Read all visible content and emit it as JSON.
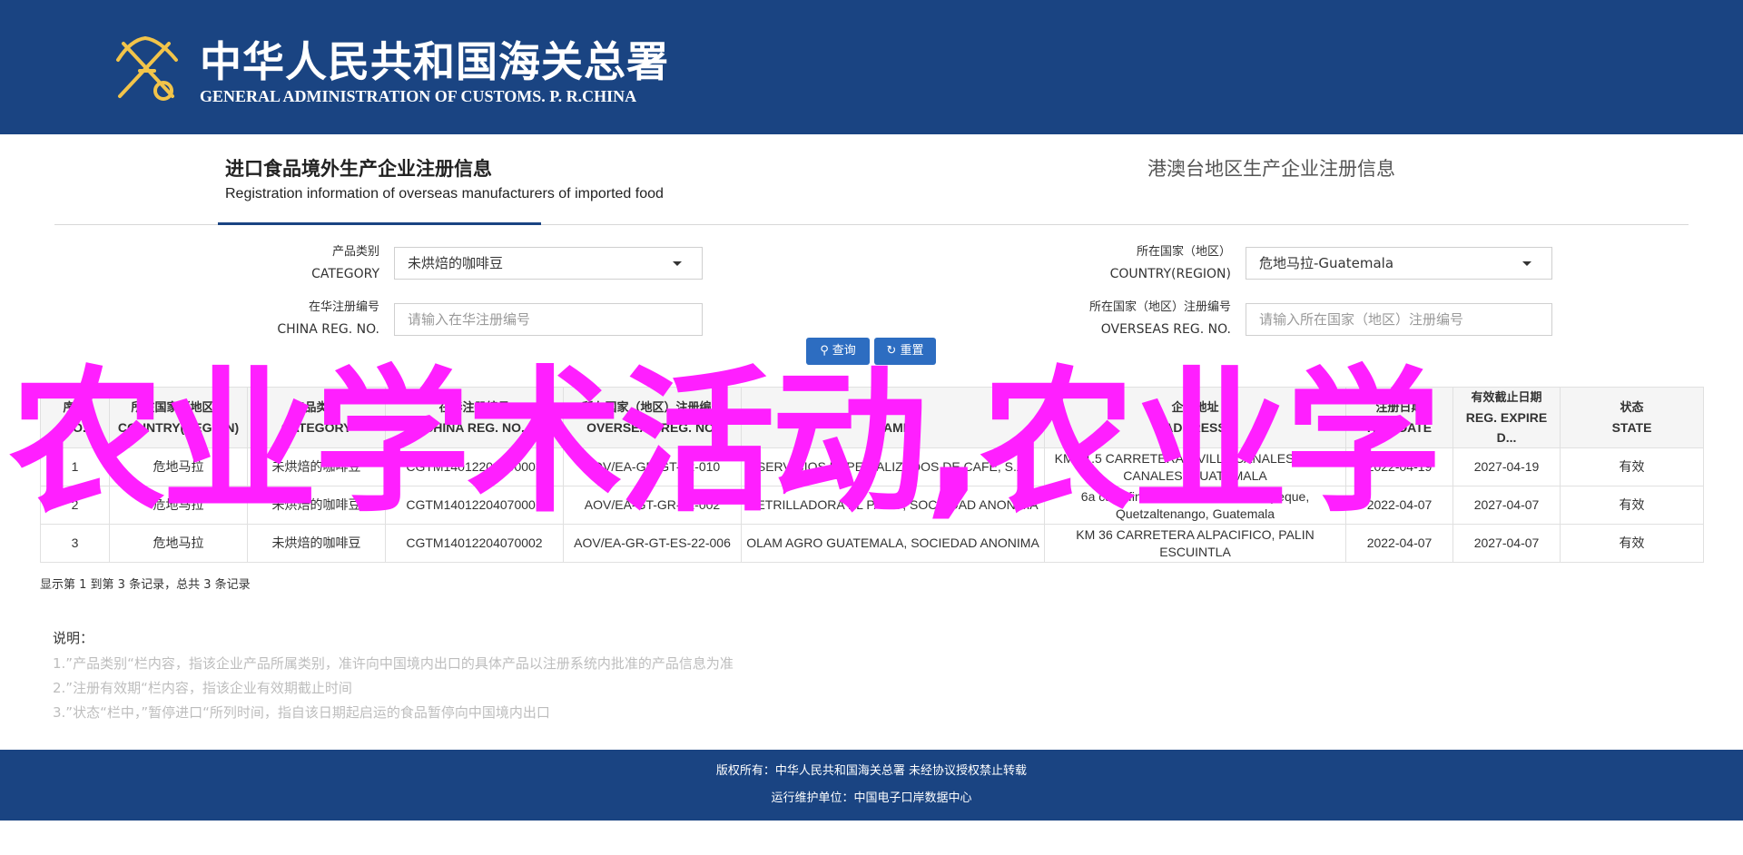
{
  "header": {
    "logo_cn": "中华人民共和国海关总署",
    "logo_en": "GENERAL ADMINISTRATION OF CUSTOMS. P. R.CHINA"
  },
  "tabs": {
    "active_cn": "进口食品境外生产企业注册信息",
    "active_en": "Registration information of overseas manufacturers of imported food",
    "other": "港澳台地区生产企业注册信息"
  },
  "form": {
    "category_label_cn": "产品类别",
    "category_label_en": "CATEGORY",
    "category_value": "未烘焙的咖啡豆",
    "country_label_cn": "所在国家（地区）",
    "country_label_en": "COUNTRY(REGION)",
    "country_value": "危地马拉-Guatemala",
    "china_reg_label_cn": "在华注册编号",
    "china_reg_label_en": "CHINA REG. NO.",
    "china_reg_placeholder": "请输入在华注册编号",
    "overseas_reg_label_cn": "所在国家（地区）注册编号",
    "overseas_reg_label_en": "OVERSEAS REG. NO.",
    "overseas_reg_placeholder": "请输入所在国家（地区）注册编号",
    "search_label": "查询",
    "reset_label": "重置"
  },
  "table": {
    "headers": [
      {
        "cn": "序号",
        "en": "NO."
      },
      {
        "cn": "所在国家（地区）",
        "en": "COUNTRY(REGION)"
      },
      {
        "cn": "产品类别",
        "en": "CATEGORY"
      },
      {
        "cn": "在华注册编号",
        "en": "CHINA REG. NO."
      },
      {
        "cn": "所在国家（地区）注册编号",
        "en": "OVERSEAS REG. NO."
      },
      {
        "cn": "企业名称",
        "en": "NAME"
      },
      {
        "cn": "企业地址",
        "en": "ADDRESS"
      },
      {
        "cn": "注册日期",
        "en": "REG.DATE"
      },
      {
        "cn": "有效截止日期",
        "en": "REG. EXPIRE D..."
      },
      {
        "cn": "状态",
        "en": "STATE"
      }
    ],
    "rows": [
      [
        "1",
        "危地马拉",
        "未烘焙的咖啡豆",
        "CGTM14012204190003",
        "AOV/EA-GR-GT-22-010",
        "SERVICIOS ESPECIALIZADOS DE CAFE, S.A.",
        "KM 21.5 CARRETERA A VILLA CANALES, VILLA CANALES, GUATEMALA",
        "2022-04-19",
        "2027-04-19",
        "有效"
      ],
      [
        "2",
        "危地马拉",
        "未烘焙的咖啡豆",
        "CGTM14012204070001",
        "AOV/EA-GT-GR-22-002",
        "RETRILLADORA EL PATIO, SOCIEDAD ANONIMA",
        "6a calle final 25-95 zona 3, Coatepeque, Quetzaltenango, Guatemala",
        "2022-04-07",
        "2027-04-07",
        "有效"
      ],
      [
        "3",
        "危地马拉",
        "未烘焙的咖啡豆",
        "CGTM14012204070002",
        "AOV/EA-GR-GT-ES-22-006",
        "OLAM AGRO GUATEMALA, SOCIEDAD ANONIMA",
        "KM 36 CARRETERA ALPACIFICO, PALIN ESCUINTLA",
        "2022-04-07",
        "2027-04-07",
        "有效"
      ]
    ]
  },
  "pager_text": "显示第 1 到第 3 条记录，总共 3 条记录",
  "notes": {
    "title": "说明：",
    "items": [
      "1.”产品类别“栏内容，指该企业产品所属类别，准许向中国境内出口的具体产品以注册系统内批准的产品信息为准",
      "2.”注册有效期“栏内容，指该企业有效期截止时间",
      "3.”状态“栏中，”暂停进口“所列时间，指自该日期起启运的食品暂停向中国境内出口"
    ]
  },
  "overlay_text": "农业学术活动,农业学",
  "footer": {
    "line1": "版权所有：中华人民共和国海关总署 未经协议授权禁止转载",
    "line2": "运行维护单位：中国电子口岸数据中心"
  },
  "colors": {
    "brand": "#1a4482",
    "button": "#2d6dc1",
    "overlay": "#ff1fff"
  },
  "icons": [
    "customs-emblem-icon",
    "caret-down-icon",
    "search-icon",
    "refresh-icon"
  ]
}
